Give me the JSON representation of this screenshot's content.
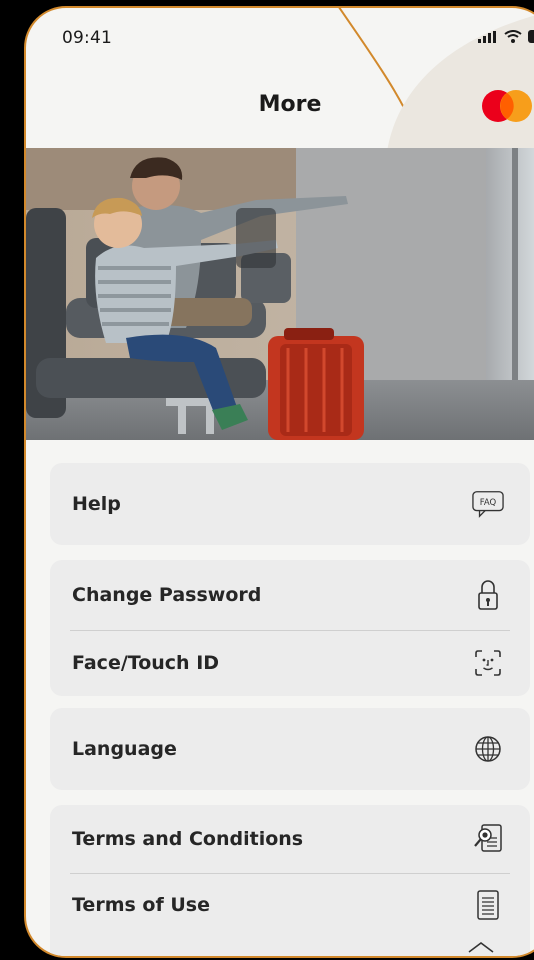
{
  "status_bar": {
    "time": "09:41",
    "icons": [
      "signal-icon",
      "wifi-icon",
      "battery-icon"
    ]
  },
  "header": {
    "title": "More",
    "logo": "mastercard-logo"
  },
  "hero_image": {
    "subject": "father-and-son-at-airport-photo"
  },
  "menu": {
    "help": {
      "label": "Help",
      "icon": "faq-icon",
      "icon_text": "FAQ"
    },
    "change_password": {
      "label": "Change Password",
      "icon": "lock-icon"
    },
    "face_touch_id": {
      "label": "Face/Touch ID",
      "icon": "face-id-icon"
    },
    "language": {
      "label": "Language",
      "icon": "globe-icon"
    },
    "terms_conditions": {
      "label": "Terms and Conditions",
      "icon": "document-search-icon"
    },
    "terms_of_use": {
      "label": "Terms of Use",
      "icon": "document-icon"
    }
  },
  "colors": {
    "accent_orange": "#d2892c",
    "background": "#f5f5f3",
    "card": "#ececec",
    "mastercard_red": "#eb001b",
    "mastercard_yellow": "#f79e1b",
    "text": "#262626"
  }
}
